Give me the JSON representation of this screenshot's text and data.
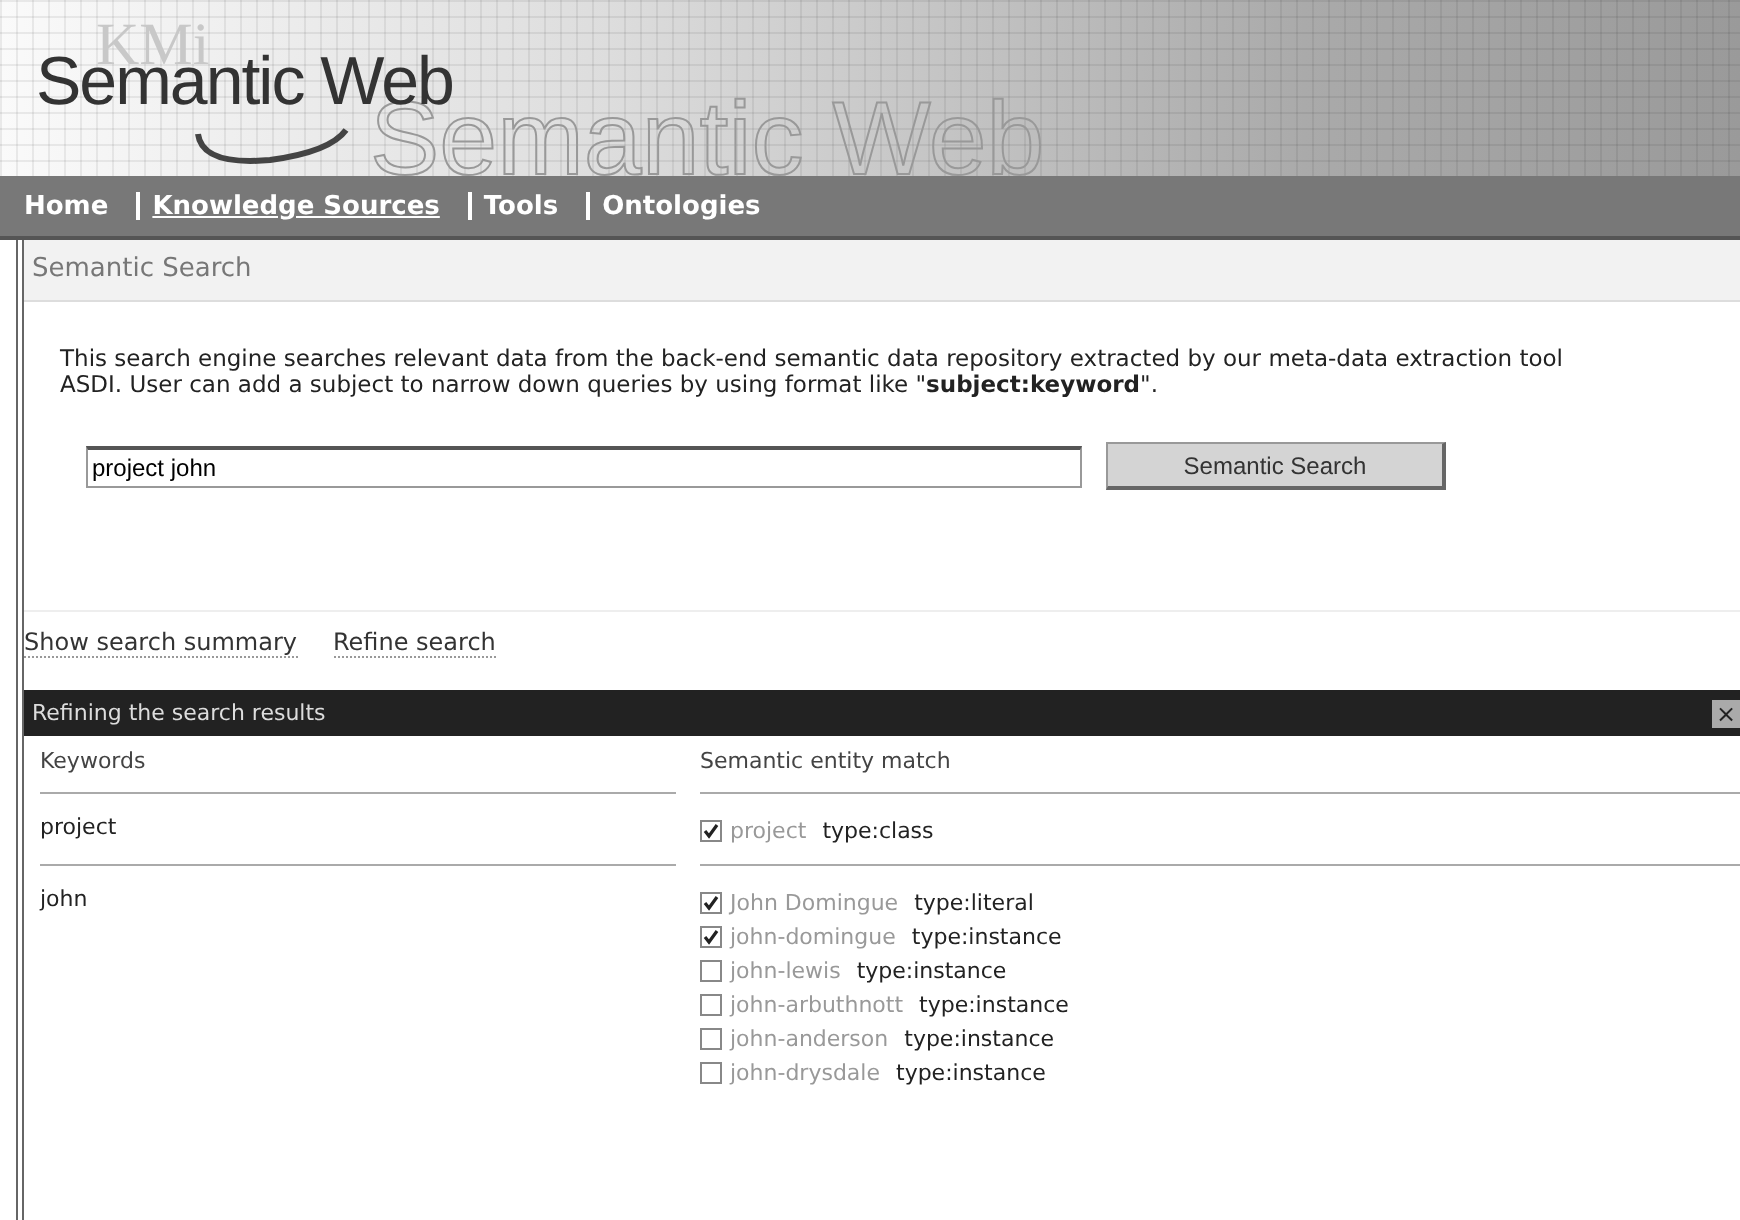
{
  "banner": {
    "logo_small": "KMi",
    "logo": "Semantic Web",
    "logo_backdrop": "Semantic Web"
  },
  "nav": [
    {
      "label": "Home",
      "selected": false
    },
    {
      "label": "Knowledge Sources",
      "selected": true
    },
    {
      "label": "Tools",
      "selected": false
    },
    {
      "label": "Ontologies",
      "selected": false
    }
  ],
  "section_title": "Semantic Search",
  "description": "This search engine searches relevant data from the back-end semantic data repository extracted by our meta-data extraction tool ASDI. User can add a subject to narrow down queries by using format like \"**subject:keyword**\".",
  "search": {
    "value": "project john",
    "button": "Semantic Search"
  },
  "links": [
    "Show search summary",
    "Refine search"
  ],
  "panel": {
    "title": "Refining the search results",
    "close": "×",
    "columns": [
      "Keywords",
      "Semantic entity match"
    ],
    "rows": [
      {
        "keyword": "project",
        "matches": [
          {
            "name": "project",
            "type": "type:class",
            "checked": true
          }
        ]
      },
      {
        "keyword": "john",
        "matches": [
          {
            "name": "John Domingue",
            "type": "type:literal",
            "checked": true
          },
          {
            "name": "john-domingue",
            "type": "type:instance",
            "checked": true
          },
          {
            "name": "john-lewis",
            "type": "type:instance",
            "checked": false
          },
          {
            "name": "john-arbuthnott",
            "type": "type:instance",
            "checked": false
          },
          {
            "name": "john-anderson",
            "type": "type:instance",
            "checked": false
          },
          {
            "name": "john-drysdale",
            "type": "type:instance",
            "checked": false
          }
        ]
      }
    ]
  }
}
